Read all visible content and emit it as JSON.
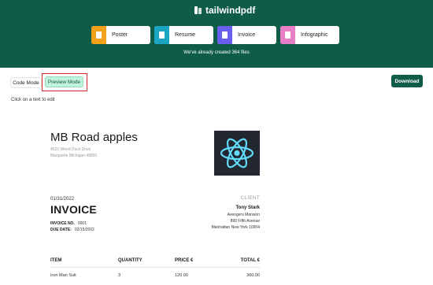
{
  "header": {
    "brand": "tailwindpdf",
    "templates": [
      {
        "label": "Poster",
        "color": "#f2a11a"
      },
      {
        "label": "Resume",
        "color": "#1aa6c2"
      },
      {
        "label": "Invoice",
        "color": "#6a5ef0"
      },
      {
        "label": "Infographic",
        "color": "#e87ec6"
      }
    ],
    "counter": "We've already created 364 files"
  },
  "toolbar": {
    "code_mode": "Code Mode",
    "preview_mode": "Preview Mode",
    "download": "Download",
    "hint": "Click on a text to edit"
  },
  "invoice": {
    "company": "MB Road apples",
    "address1": "4520 Wood Duck Drive",
    "address2": "Marquette Michigan 49855",
    "date": "01/31/2022",
    "title": "INVOICE",
    "invoice_no_label": "INVOICE NO.",
    "invoice_no": "0001",
    "due_date_label": "DUE DATE:",
    "due_date": "02/15/2002",
    "client_label": "CLIENT",
    "client_name": "Tony Stark",
    "client_line1": "Avengers Mansion",
    "client_line2": "890 Fifth Avenue",
    "client_line3": "Manhattan New York 10004",
    "columns": [
      "ITEM",
      "QUANTITY",
      "PRICE €",
      "TOTAL €"
    ],
    "rows": [
      {
        "item": "Iron Man Suit",
        "quantity": "3",
        "price": "120.00",
        "total": "360.00"
      }
    ]
  }
}
